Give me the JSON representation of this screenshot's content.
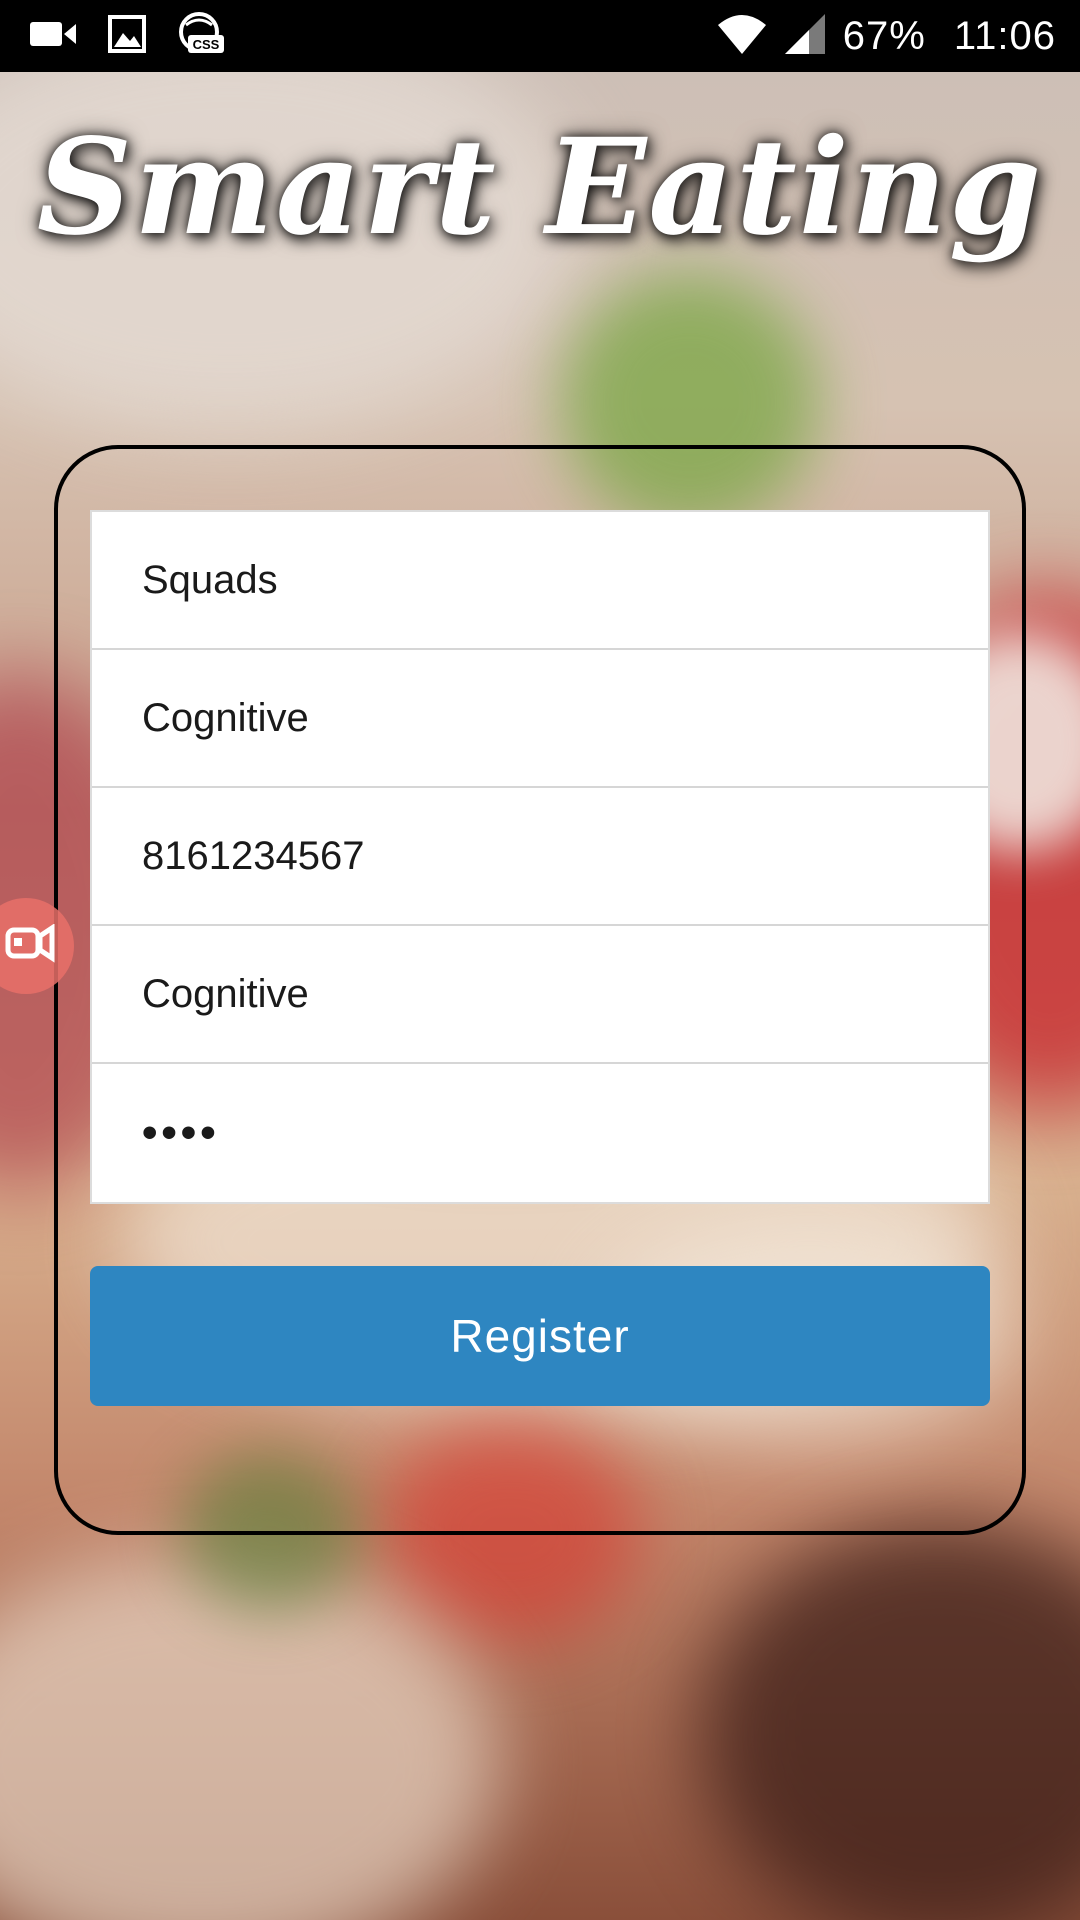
{
  "status_bar": {
    "battery": "67%",
    "time": "11:06",
    "icons": [
      "video-camera-icon",
      "image-icon",
      "css-app-icon",
      "wifi-icon",
      "cell-signal-icon"
    ]
  },
  "app": {
    "title": "Smart Eating"
  },
  "form": {
    "fields": [
      {
        "name": "first-name",
        "value": "Squads"
      },
      {
        "name": "last-name",
        "value": "Cognitive"
      },
      {
        "name": "phone",
        "value": "8161234567"
      },
      {
        "name": "username",
        "value": "Cognitive"
      },
      {
        "name": "password",
        "value": "••••"
      }
    ],
    "register_label": "Register"
  },
  "colors": {
    "accent": "#2e86c1",
    "card_border": "#000000",
    "status_bar": "#000000",
    "floating_bubble": "#e87068"
  },
  "floating_button": {
    "icon": "screen-recorder-icon"
  }
}
